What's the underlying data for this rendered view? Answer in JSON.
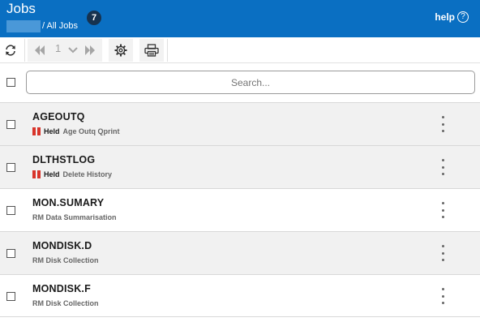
{
  "header": {
    "title": "Jobs",
    "breadcrumb": "/ All Jobs",
    "count": "7",
    "help_label": "help",
    "help_icon": "help-circle-icon",
    "color": "#0a6fc2"
  },
  "toolbar": {
    "refresh_icon": "refresh-icon",
    "first_icon": "first-page-icon",
    "page": "1",
    "page_dropdown_icon": "chevron-down-icon",
    "last_icon": "last-page-icon",
    "settings_icon": "gear-icon",
    "print_icon": "print-icon"
  },
  "search": {
    "placeholder": "Search..."
  },
  "jobs": [
    {
      "name": "AGEOUTQ",
      "status": "Held",
      "description": "Age Outq Qprint"
    },
    {
      "name": "DLTHSTLOG",
      "status": "Held",
      "description": "Delete History"
    },
    {
      "name": "MON.SUMARY",
      "status": "",
      "description": "RM Data Summarisation"
    },
    {
      "name": "MONDISK.D",
      "status": "",
      "description": "RM Disk Collection"
    },
    {
      "name": "MONDISK.F",
      "status": "",
      "description": "RM Disk Collection"
    }
  ],
  "colors": {
    "held": "#d8342a",
    "header": "#0a6fc2",
    "badge": "#16324f"
  }
}
